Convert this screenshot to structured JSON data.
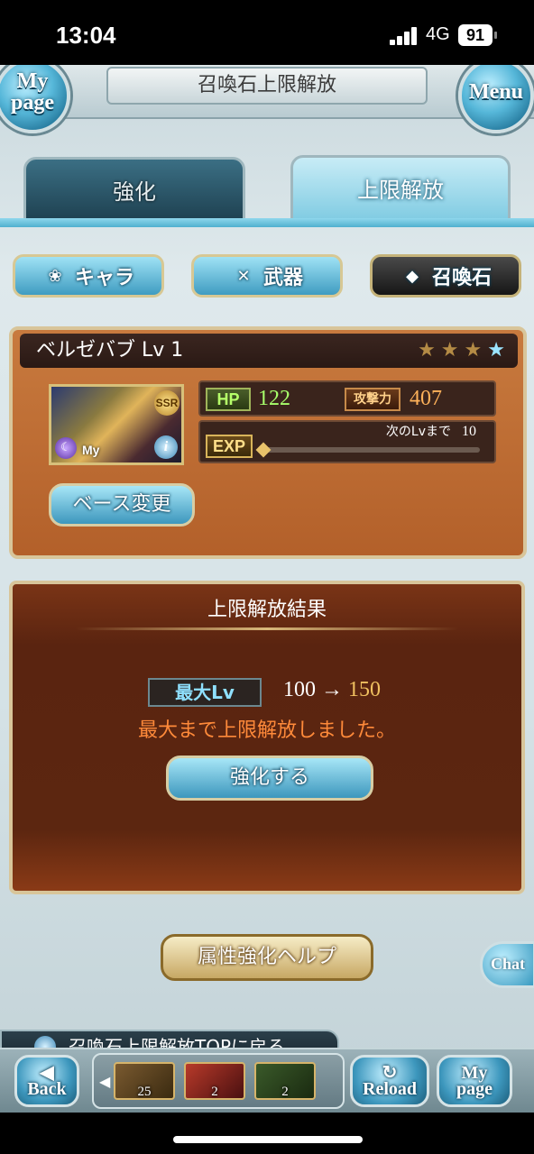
{
  "status_bar": {
    "time": "13:04",
    "network": "4G",
    "battery": "91"
  },
  "header": {
    "title": "召喚石上限解放",
    "mypage_line1": "My",
    "mypage_line2": "page",
    "menu_label": "Menu"
  },
  "tabs": [
    {
      "label": "強化"
    },
    {
      "label": "上限解放"
    }
  ],
  "categories": [
    {
      "label": "キャラ"
    },
    {
      "label": "武器"
    },
    {
      "label": "召喚石"
    }
  ],
  "summon": {
    "name_level": "ベルゼバブ Lv 1",
    "rarity_badge": "SSR",
    "my_badge": "My",
    "uncap_stars_total": 4,
    "uncap_stars_filled": 1,
    "hp_label": "HP",
    "hp": "122",
    "atk_label": "攻撃力",
    "atk": "407",
    "exp_label": "EXP",
    "next_lv_label": "次のLvまで",
    "next_lv_value": "10",
    "exp_progress": 0,
    "base_change_label": "ベース変更"
  },
  "result": {
    "title": "上限解放結果",
    "max_lv_label": "最大Lv",
    "lv_from": "100",
    "arrow": "→",
    "lv_to": "150",
    "message": "最大まで上限解放しました。",
    "enhance_label": "強化する"
  },
  "help_label": "属性強化ヘルプ",
  "chat_label": "Chat",
  "back_to_top_label": "召喚石上限解放TOPに戻る",
  "bottom_nav": {
    "back_label": "Back",
    "reload_label": "Reload",
    "mypage_line1": "My",
    "mypage_line2": "page",
    "items": [
      {
        "count": "25"
      },
      {
        "count": "2"
      },
      {
        "count": "2"
      }
    ]
  }
}
